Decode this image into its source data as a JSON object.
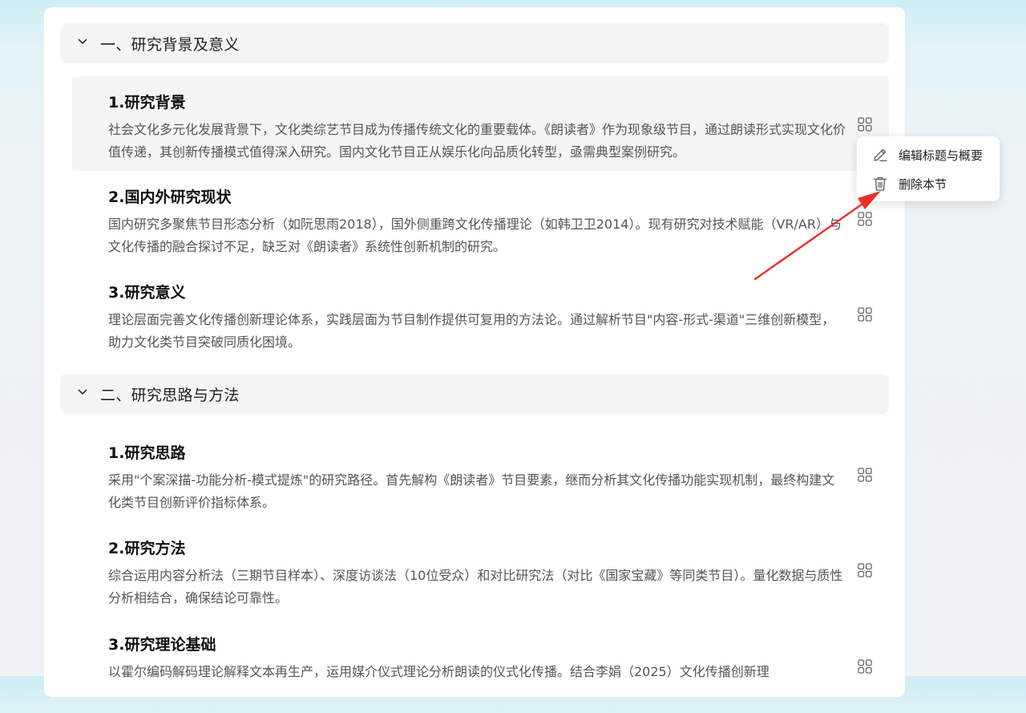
{
  "chapters": [
    {
      "title": "一、研究背景及意义",
      "sections": [
        {
          "title": "1.研究背景",
          "desc": "社会文化多元化发展背景下，文化类综艺节目成为传播传统文化的重要载体。《朗读者》作为现象级节目，通过朗读形式实现文化价值传递，其创新传播模式值得深入研究。国内文化节目正从娱乐化向品质化转型，亟需典型案例研究。"
        },
        {
          "title": "2.国内外研究现状",
          "desc": "国内研究多聚焦节目形态分析（如阮思雨2018），国外侧重跨文化传播理论（如韩卫卫2014）。现有研究对技术赋能（VR/AR）与文化传播的融合探讨不足，缺乏对《朗读者》系统性创新机制的研究。"
        },
        {
          "title": "3.研究意义",
          "desc": "理论层面完善文化传播创新理论体系，实践层面为节目制作提供可复用的方法论。通过解析节目\"内容-形式-渠道\"三维创新模型，助力文化类节目突破同质化困境。"
        }
      ]
    },
    {
      "title": "二、研究思路与方法",
      "sections": [
        {
          "title": "1.研究思路",
          "desc": "采用\"个案深描-功能分析-模式提炼\"的研究路径。首先解构《朗读者》节目要素，继而分析其文化传播功能实现机制，最终构建文化类节目创新评价指标体系。"
        },
        {
          "title": "2.研究方法",
          "desc": "综合运用内容分析法（三期节目样本）、深度访谈法（10位受众）和对比研究法（对比《国家宝藏》等同类节目）。量化数据与质性分析相结合，确保结论可靠性。"
        },
        {
          "title": "3.研究理论基础",
          "desc": "以霍尔编码解码理论解释文本再生产，运用媒介仪式理论分析朗读的仪式化传播。结合李娟（2025）文化传播创新理"
        }
      ]
    }
  ],
  "context_menu": {
    "edit_label": "编辑标题与概要",
    "delete_label": "删除本节",
    "edit_icon": "pencil-icon",
    "delete_icon": "trash-icon"
  },
  "icons": {
    "section_action": "grid-icon",
    "chapter_toggle": "chevron-down-icon"
  },
  "colors": {
    "annotation_arrow": "#e8302a",
    "hover_background": "#f5f5f6"
  }
}
